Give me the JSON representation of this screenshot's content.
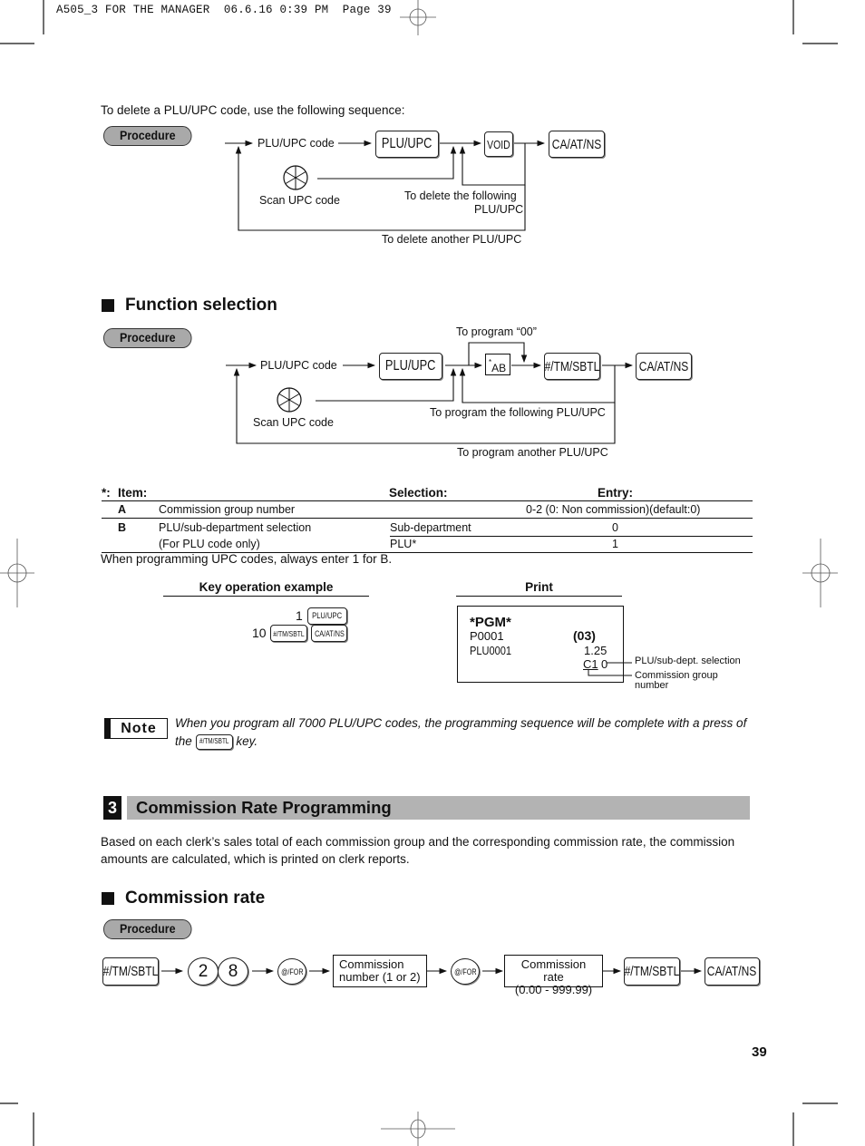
{
  "header": {
    "slug": "A505_3 FOR THE MANAGER  06.6.16 0:39 PM  Page 39"
  },
  "delete_section": {
    "intro": "To delete a PLU/UPC code, use the following sequence:",
    "procedure_label": "Procedure",
    "plu_upc_code": "PLU/UPC code",
    "scan_upc": "Scan UPC code",
    "keys": {
      "plu_upc": "PLU/UPC",
      "void": "VOID",
      "ca_at_ns": "CA/AT/NS"
    },
    "loop_following_1": "To delete the following",
    "loop_following_2": "PLU/UPC",
    "loop_another": "To delete another PLU/UPC"
  },
  "function_selection": {
    "heading": "Function selection",
    "procedure_label": "Procedure",
    "plu_upc_code": "PLU/UPC code",
    "scan_upc": "Scan UPC code",
    "program_00": "To program “00”",
    "ab_star": "*",
    "ab_box": "AB",
    "keys": {
      "plu_upc": "PLU/UPC",
      "tm_sbtl": "#/TM/SBTL",
      "ca_at_ns": "CA/AT/NS"
    },
    "loop_following": "To program the following PLU/UPC",
    "loop_another": "To program another PLU/UPC"
  },
  "items_table": {
    "star": "*:",
    "headers": {
      "item": "Item:",
      "selection": "Selection:",
      "entry": "Entry:"
    },
    "rows": [
      {
        "code": "A",
        "item": "Commission group number",
        "selection": "",
        "entry": "0-2 (0: Non commission)(default:0)"
      },
      {
        "code": "B",
        "item": "PLU/sub-department selection",
        "selection": "Sub-department",
        "entry": "0"
      },
      {
        "code": "",
        "item": "(For PLU code only)",
        "selection": "PLU*",
        "entry": "1"
      }
    ],
    "footnote": "When programming UPC codes, always enter 1 for B."
  },
  "example": {
    "key_op_title": "Key operation example",
    "print_title": "Print",
    "line1_num": "1",
    "line1_key": "PLU/UPC",
    "line2_num": "10",
    "line2_key1": "#/TM/SBTL",
    "line2_key2": "CA/AT/NS",
    "receipt": {
      "pgm": "*PGM*",
      "p_code": "P0001",
      "p_num": "(03)",
      "plu": "PLU0001",
      "price": "1.25",
      "c_code": "C1",
      "c_val": "0"
    },
    "annot_sel": "PLU/sub-dept. selection",
    "annot_group_1": "Commission group",
    "annot_group_2": "number"
  },
  "note": {
    "tag": "Note",
    "text_before": "When you program all 7000 PLU/UPC codes, the programming sequence will be complete with a press of the",
    "key": "#/TM/SBTL",
    "text_after": "key."
  },
  "section3": {
    "number": "3",
    "title": "Commission Rate Programming",
    "body": "Based on each clerk’s sales total of each commission group and the corresponding commission rate, the commission amounts are calculated, which is printed on clerk reports.",
    "subheading": "Commission rate",
    "procedure_label": "Procedure",
    "seq": {
      "tm_sbtl": "#/TM/SBTL",
      "digit2": "2",
      "digit8": "8",
      "at_for": "@/FOR",
      "comm_num": "Commission number (1 or 2)",
      "comm_num_l1": "Commission",
      "comm_num_l2": "number (1 or 2)",
      "comm_rate_l1": "Commission rate",
      "comm_rate_l2": "(0.00 - 999.99)",
      "ca_at_ns": "CA/AT/NS"
    }
  },
  "footer": {
    "page_number": "39"
  }
}
